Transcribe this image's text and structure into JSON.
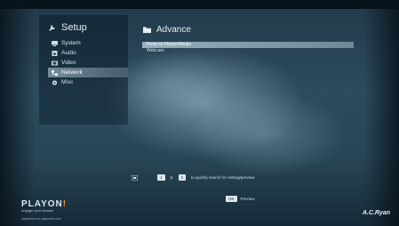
{
  "sidebar": {
    "title": "Setup",
    "items": [
      {
        "label": "System",
        "icon": "monitor-icon"
      },
      {
        "label": "Audio",
        "icon": "speaker-icon"
      },
      {
        "label": "Video",
        "icon": "film-icon"
      },
      {
        "label": "Network",
        "icon": "network-icon",
        "selected": true
      },
      {
        "label": "Misc",
        "icon": "gear-icon"
      }
    ]
  },
  "main": {
    "title": "Advance",
    "rows": [
      {
        "label": "Proxy to Playon/Media",
        "selected": true
      },
      {
        "label": "Webcam",
        "selected": false
      }
    ]
  },
  "footer": {
    "hint_text": "to quickly search for setting/preview",
    "key_a": "1",
    "key_b": "2",
    "key_sep": "&",
    "hint2_key": "OK",
    "hint2_text": "Preview"
  },
  "branding": {
    "brand_main": "PLAYON",
    "brand_accent": "!",
    "tagline": "engage your senses",
    "url": "playonhd.com  playonhd.com",
    "signature": "A.C.Ryan"
  },
  "colors": {
    "accent": "#f29326",
    "selection": "#c6deea"
  }
}
